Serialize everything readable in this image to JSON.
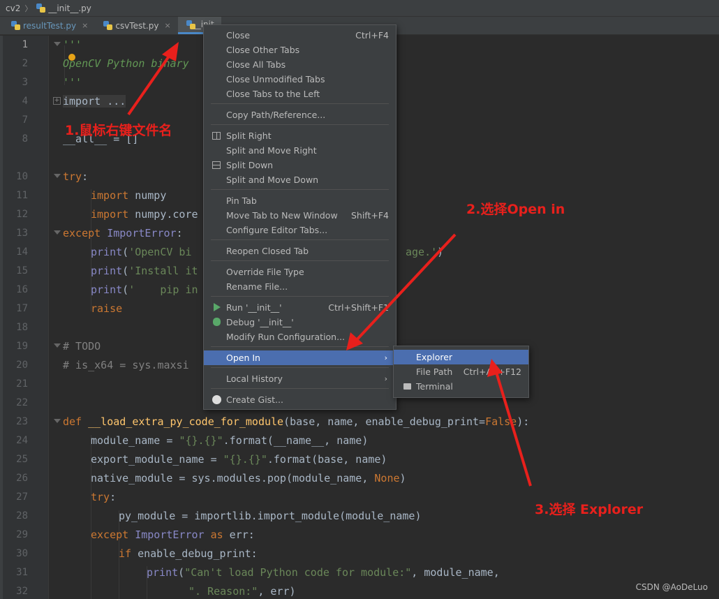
{
  "breadcrumb": {
    "root": "cv2",
    "file": "__init__.py"
  },
  "tabs": [
    {
      "label": "resultTest.py",
      "close": "×"
    },
    {
      "label": "csvTest.py",
      "close": "×"
    },
    {
      "label": "__init"
    }
  ],
  "gutter": {
    "line_numbers": [
      "1",
      "2",
      "3",
      "4",
      "7",
      "8",
      "10",
      "11",
      "12",
      "13",
      "14",
      "15",
      "16",
      "17",
      "18",
      "19",
      "20",
      "21",
      "22",
      "23",
      "24",
      "25",
      "26",
      "27",
      "28",
      "29",
      "30",
      "31",
      "32"
    ]
  },
  "code": {
    "l1": "'''",
    "l2": "OpenCV Python binary",
    "l3": "'''",
    "l4": "import ...",
    "l8": "__all__ = []",
    "l10_kw": "try",
    "l10_p": ":",
    "l11_kw": "import",
    "l11_rest": " numpy",
    "l12_kw": "import",
    "l12_rest": " numpy.core",
    "l13_kw": "except",
    "l13_cls": " ImportError",
    "l13_p": ":",
    "l14_fn": "print",
    "l14_a": "(",
    "l14_s1": "'OpenCV bi",
    "l14_s2": "age.'",
    "l14_e": ")",
    "l15_fn": "print",
    "l15_a": "(",
    "l15_s": "'Install it",
    "l16_fn": "print",
    "l16_a": "(",
    "l16_s": "'    pip in",
    "l17_kw": "raise",
    "l19": "# TODO",
    "l20": "# is_x64 = sys.maxsi",
    "l23_kw": "def",
    "l23_fn": " __load_extra_py_code_for_module",
    "l23_a": "(base, name, enable_debug_print=",
    "l23_v": "False",
    "l23_e": "):",
    "l24_a": "module_name = ",
    "l24_s": "\"{}.{}\"",
    "l24_e": ".format(__name__, name)",
    "l25_a": "export_module_name = ",
    "l25_s": "\"{}.{}\"",
    "l25_e": ".format(base, name)",
    "l26_a": "native_module = sys.modules.pop(module_name, ",
    "l26_v": "None",
    "l26_e": ")",
    "l27_kw": "try",
    "l27_p": ":",
    "l28": "py_module = importlib.import_module(module_name)",
    "l29_kw": "except",
    "l29_cls": " ImportError",
    "l29_kw2": " as",
    "l29_e": " err:",
    "l30_kw": "if",
    "l30_e": " enable_debug_print:",
    "l31_fn": "print",
    "l31_a": "(",
    "l31_s": "\"Can't load Python code for module:\"",
    "l31_e": ", module_name,",
    "l32_s": "\". Reason:\"",
    "l32_e": ", err)"
  },
  "context_menu": {
    "items": [
      {
        "label": "Close",
        "shortcut": "Ctrl+F4"
      },
      {
        "label": "Close Other Tabs"
      },
      {
        "label": "Close All Tabs"
      },
      {
        "label": "Close Unmodified Tabs"
      },
      {
        "label": "Close Tabs to the Left"
      },
      {
        "label": "Copy Path/Reference..."
      },
      {
        "label": "Split Right"
      },
      {
        "label": "Split and Move Right"
      },
      {
        "label": "Split Down"
      },
      {
        "label": "Split and Move Down"
      },
      {
        "label": "Pin Tab"
      },
      {
        "label": "Move Tab to New Window",
        "shortcut": "Shift+F4"
      },
      {
        "label": "Configure Editor Tabs..."
      },
      {
        "label": "Reopen Closed Tab"
      },
      {
        "label": "Override File Type"
      },
      {
        "label": "Rename File..."
      },
      {
        "label": "Run '__init__'",
        "shortcut": "Ctrl+Shift+F1"
      },
      {
        "label": "Debug '__init__'"
      },
      {
        "label": "Modify Run Configuration..."
      },
      {
        "label": "Open In",
        "arrow": "›"
      },
      {
        "label": "Local History",
        "arrow": "›"
      },
      {
        "label": "Create Gist..."
      }
    ]
  },
  "submenu": {
    "items": [
      {
        "label": "Explorer"
      },
      {
        "label": "File Path",
        "shortcut": "Ctrl+Alt+F12"
      },
      {
        "label": "Terminal"
      }
    ]
  },
  "annotations": {
    "step1": "1.鼠标右键文件名",
    "step2": "2.选择Open in",
    "step3": "3.选择 Explorer",
    "color": "#e8201c"
  },
  "watermark": "CSDN @AoDeLuo",
  "colors": {
    "editor_bg": "#2b2b2b",
    "menu_bg": "#3c3f41",
    "highlight": "#4b6eaf",
    "keyword": "#cc7832",
    "string": "#6a8759",
    "docstring": "#629755"
  }
}
